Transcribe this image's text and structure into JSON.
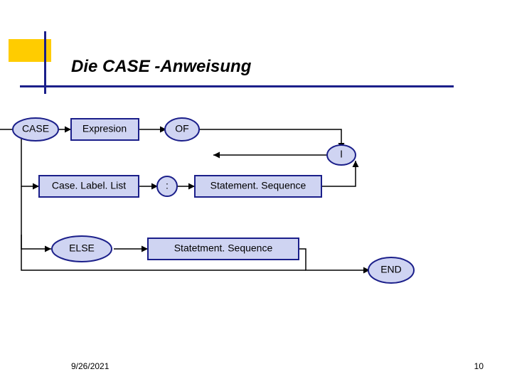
{
  "title": "Die CASE -Anweisung",
  "nodes": {
    "case": "CASE",
    "expr": "Expresion",
    "of": "OF",
    "pipe": "l",
    "caseLabel": "Case. Label. List",
    "colon": ":",
    "stmtSeq1": "Statement. Sequence",
    "else": "ELSE",
    "stmtSeq2": "Statetment. Sequence",
    "end": "END"
  },
  "footer": {
    "date": "9/26/2021",
    "page": "10"
  }
}
